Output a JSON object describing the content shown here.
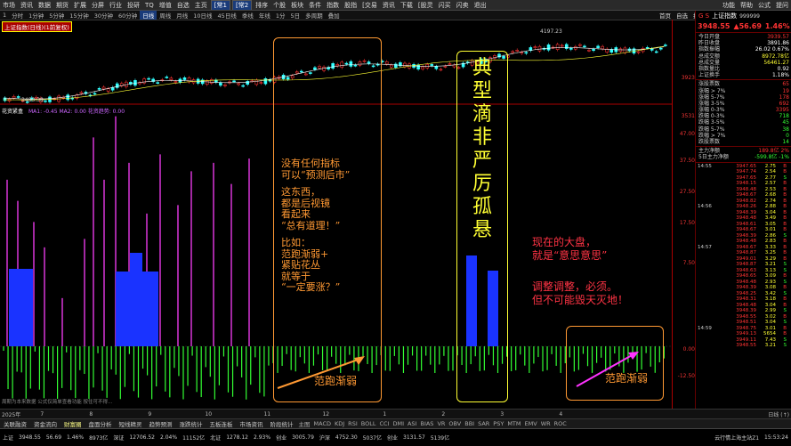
{
  "menu": {
    "items": [
      "市场",
      "资讯",
      "数据",
      "期货",
      "扩展",
      "分屏",
      "行业",
      "投研",
      "TQ",
      "增值",
      "自选",
      "主页"
    ],
    "tabs": [
      "[常1",
      "[常2"
    ],
    "mid_items": [
      "排序",
      "个股",
      "板块",
      "条件",
      "指数",
      "股指",
      "[交易",
      "资讯",
      "下载",
      "[股灵",
      "闪买",
      "闪卖",
      "退出"
    ],
    "right_items": [
      "功能",
      "帮助",
      "公式",
      "提问"
    ]
  },
  "periods": {
    "items": [
      "1",
      "分时",
      "1分钟",
      "5分钟",
      "15分钟",
      "30分钟",
      "60分钟",
      "日线",
      "周线",
      "月线",
      "10日线",
      "45日线",
      "季线",
      "年线",
      "1分",
      "5日",
      "多周期",
      "叠加"
    ],
    "selected_index": 7,
    "right_items": [
      "首页",
      "自选",
      "指标",
      "大盘",
      "F10",
      "直通",
      "关联",
      "操盘"
    ]
  },
  "chart": {
    "index_label": "上证指数(日线)(1前复权)",
    "low_label": "3483.38",
    "high_label": "4197.23",
    "macd_label": "花资紧盒",
    "macd_vals": "MA1: -0.45  MA2: 0.00  花资趋势: 0.00",
    "bottom_note": "周期为本来数据  公式仅简单查看功能 按住可不得...",
    "scale_upper": [
      "3923",
      "3531"
    ],
    "scale_lower": [
      "47.00",
      "37.50",
      "27.50",
      "17.50",
      "7.50",
      "0.00",
      "-12.50"
    ]
  },
  "annotations": {
    "left_text": [
      "没有任何指标",
      "可以“预测后市”",
      "",
      "这东西，",
      "都是后视镜",
      "看起来",
      "“总有道理！”",
      "",
      "比如：",
      "范跑渐弱+",
      "紧贴花丛",
      "就等于",
      "“一定要涨？”"
    ],
    "left_bottom": "范跑渐弱",
    "center_vertical": [
      "典",
      "型",
      "滴",
      "非",
      "严",
      "厉",
      "孤",
      "悬"
    ],
    "right_text_1": [
      "现在的大盘，",
      "就是“意思意思”"
    ],
    "right_text_2": [
      "调整调整，必须。",
      "但不可能毁天灭地！"
    ],
    "right_bottom": "范跑渐弱"
  },
  "rightpanel": {
    "title": "上证指数",
    "code": "999999",
    "price": "3948.55",
    "change": "▲56.69",
    "pct": "1.46%",
    "stats": [
      {
        "l": "今日开盘",
        "v": "3939.57",
        "c": "red"
      },
      {
        "l": "昨日收盘",
        "v": "3891.86",
        "c": "white"
      },
      {
        "l": "指数振幅",
        "v": "26.02 0.67%",
        "c": "white"
      },
      {
        "l": "总成交额",
        "v": "8972.78亿",
        "c": "yellow"
      },
      {
        "l": "总成交量",
        "v": "56461.27",
        "c": "yellow"
      },
      {
        "l": "指数量比",
        "v": "0.92",
        "c": "white"
      },
      {
        "l": "上证换手",
        "v": "1.18%",
        "c": "white"
      }
    ],
    "breadth": [
      {
        "l": "涨股票数",
        "v": "65",
        "c": "red"
      },
      {
        "l": "涨幅 > 7%",
        "v": "19",
        "c": "red"
      },
      {
        "l": "涨幅 5-7%",
        "v": "178",
        "c": "red"
      },
      {
        "l": "涨幅 3-5%",
        "v": "692",
        "c": "red"
      },
      {
        "l": "涨幅 0-3%",
        "v": "3395",
        "c": "red"
      },
      {
        "l": "跌幅 0-3%",
        "v": "718",
        "c": "green"
      },
      {
        "l": "跌幅 3-5%",
        "v": "45",
        "c": "green"
      },
      {
        "l": "跌幅 5-7%",
        "v": "38",
        "c": "green"
      },
      {
        "l": "跌幅 > 7%",
        "v": "0",
        "c": "green"
      },
      {
        "l": "跌股票数",
        "v": "14",
        "c": "green"
      }
    ],
    "flow": [
      {
        "l": "主力净额",
        "v": "189.8亿  2%",
        "c": "red"
      },
      {
        "l": "5日主力净额",
        "v": "-599.8亿  -1%",
        "c": "green"
      }
    ],
    "ticks": [
      {
        "t": "14:55",
        "p": "3947.65",
        "v": "2.75",
        "b": "B"
      },
      {
        "t": "",
        "p": "3947.74",
        "v": "2.54",
        "b": "B"
      },
      {
        "t": "",
        "p": "3947.65",
        "v": "2.77",
        "b": "S"
      },
      {
        "t": "",
        "p": "3948.15",
        "v": "2.57",
        "b": "B"
      },
      {
        "t": "",
        "p": "3948.48",
        "v": "2.53",
        "b": "B"
      },
      {
        "t": "",
        "p": "3948.67",
        "v": "2.68",
        "b": "B"
      },
      {
        "t": "",
        "p": "3948.82",
        "v": "2.74",
        "b": "B"
      },
      {
        "t": "14:56",
        "p": "3948.26",
        "v": "2.88",
        "b": "B"
      },
      {
        "t": "",
        "p": "3948.39",
        "v": "3.04",
        "b": "B"
      },
      {
        "t": "",
        "p": "3948.48",
        "v": "3.49",
        "b": "B"
      },
      {
        "t": "",
        "p": "3948.61",
        "v": "3.05",
        "b": "B"
      },
      {
        "t": "",
        "p": "3948.67",
        "v": "3.01",
        "b": "B"
      },
      {
        "t": "",
        "p": "3948.39",
        "v": "2.86",
        "b": "S"
      },
      {
        "t": "",
        "p": "3948.48",
        "v": "2.83",
        "b": "B"
      },
      {
        "t": "14:57",
        "p": "3948.67",
        "v": "3.33",
        "b": "B"
      },
      {
        "t": "",
        "p": "3948.87",
        "v": "3.25",
        "b": "B"
      },
      {
        "t": "",
        "p": "3949.01",
        "v": "3.29",
        "b": "B"
      },
      {
        "t": "",
        "p": "3948.87",
        "v": "3.21",
        "b": "S"
      },
      {
        "t": "",
        "p": "3948.63",
        "v": "3.13",
        "b": "S"
      },
      {
        "t": "",
        "p": "3948.65",
        "v": "3.09",
        "b": "B"
      },
      {
        "t": "",
        "p": "3948.48",
        "v": "2.93",
        "b": "S"
      },
      {
        "t": "",
        "p": "3948.39",
        "v": "3.08",
        "b": "B"
      },
      {
        "t": "",
        "p": "3948.25",
        "v": "3.42",
        "b": "S"
      },
      {
        "t": "",
        "p": "3948.31",
        "v": "3.18",
        "b": "B"
      },
      {
        "t": "",
        "p": "3948.48",
        "v": "3.04",
        "b": "B"
      },
      {
        "t": "",
        "p": "3948.39",
        "v": "2.99",
        "b": "S"
      },
      {
        "t": "",
        "p": "3948.55",
        "v": "3.02",
        "b": "B"
      },
      {
        "t": "",
        "p": "3948.51",
        "v": "3.04",
        "b": "S"
      },
      {
        "t": "14:59",
        "p": "3948.75",
        "v": "3.01",
        "b": "B"
      },
      {
        "t": "",
        "p": "3949.13",
        "v": "5654",
        "b": "B"
      },
      {
        "t": "",
        "p": "3949.11",
        "v": "7.43",
        "b": "S"
      },
      {
        "t": "",
        "p": "3948.55",
        "v": "3.21",
        "b": "S"
      }
    ]
  },
  "bottom_strip": {
    "year": "2025年",
    "months": [
      "7",
      "8",
      "9",
      "10",
      "11",
      "12",
      "1",
      "2",
      "3",
      "4"
    ],
    "right_label": "日线 (↑)"
  },
  "tabs": [
    "关联融资",
    "资金流向",
    "财富圈",
    "盘面分析",
    "短线精灵",
    "趋势预测",
    "涨跌统计",
    "五板连板",
    "市场资讯",
    "阶段统计"
  ],
  "indicators": [
    "主图",
    "MACD",
    "KDJ",
    "RSI",
    "BOLL",
    "CCI",
    "DMI",
    "ASI",
    "BIAS",
    "VR",
    "OBV",
    "BBI",
    "SAR",
    "PSY",
    "MTM",
    "EMV",
    "WR",
    "ROC"
  ],
  "statusbar": {
    "items": [
      {
        "l": "上证",
        "v": "3948.55",
        "c": "red"
      },
      {
        "l": "",
        "v": "56.69",
        "c": "red"
      },
      {
        "l": "",
        "v": "1.46%",
        "c": "red"
      },
      {
        "l": "",
        "v": "8973亿",
        "c": "yellow"
      },
      {
        "l": "深证",
        "v": "12706.52",
        "c": "red"
      },
      {
        "l": "",
        "v": "2.04%",
        "c": "red"
      },
      {
        "l": "",
        "v": "11152亿",
        "c": "yellow"
      },
      {
        "l": "北证",
        "v": "1278.12",
        "c": "red"
      },
      {
        "l": "",
        "v": "2.93%",
        "c": "red"
      },
      {
        "l": "创业",
        "v": "3005.79",
        "c": "red"
      },
      {
        "l": "沪深",
        "v": "4752.30",
        "c": "red"
      },
      {
        "l": "",
        "v": "5037亿",
        "c": "yellow"
      },
      {
        "l": "创业",
        "v": "3131.57",
        "c": "red"
      },
      {
        "l": "",
        "v": "5139亿",
        "c": "yellow"
      }
    ],
    "right": "云行情上海主站Z1",
    "time": "15:53:24"
  }
}
